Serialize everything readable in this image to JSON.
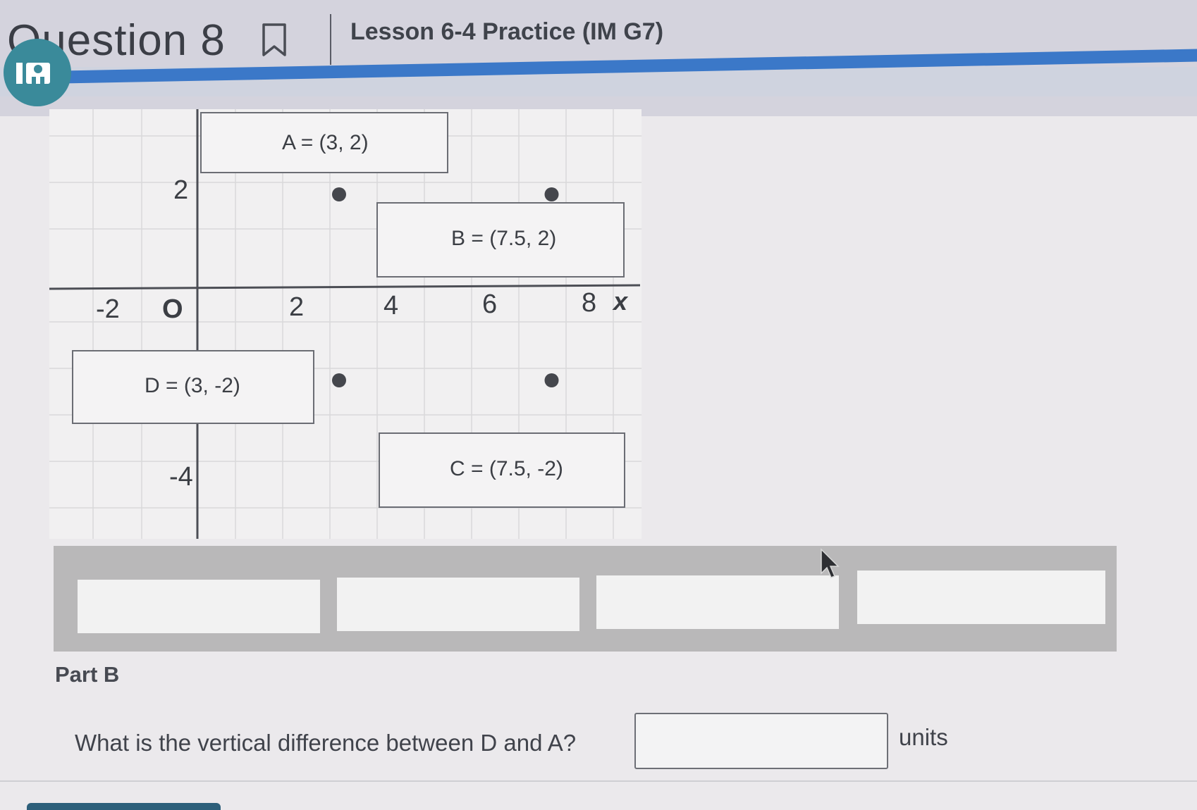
{
  "header": {
    "question_title": "Question 8",
    "lesson_title": "Lesson 6-4 Practice (IM G7)",
    "bookmark_icon": "bookmark-icon",
    "badge_icon": "im-logo-icon",
    "accent_color": "#3b78c8"
  },
  "graph": {
    "x_axis_label": "x",
    "origin_label": "O",
    "x_ticks": [
      "-2",
      "2",
      "4",
      "6",
      "8"
    ],
    "y_ticks": [
      "2",
      "-4"
    ],
    "labels": {
      "A": "A = (3, 2)",
      "B": "B = (7.5, 2)",
      "D": "D = (3, -2)",
      "C": "C = (7.5, -2)"
    },
    "points": [
      {
        "x": 3,
        "y": 2
      },
      {
        "x": 7.5,
        "y": 2
      },
      {
        "x": 3,
        "y": -2
      },
      {
        "x": 7.5,
        "y": -2
      }
    ]
  },
  "drop_zone": {
    "buckets": [
      "",
      "",
      "",
      ""
    ]
  },
  "part_b": {
    "label": "Part B",
    "question": "What is the vertical difference between D and A?",
    "answer_value": "",
    "units": "units"
  }
}
